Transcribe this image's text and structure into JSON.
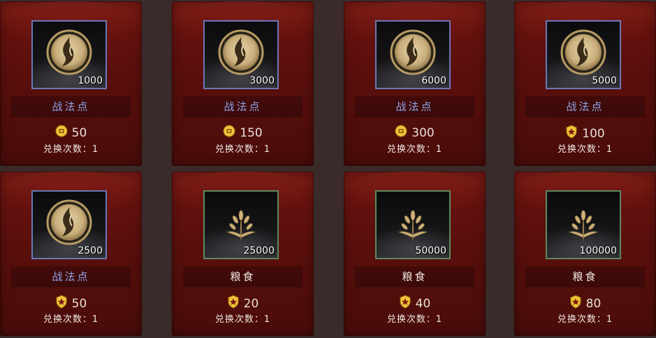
{
  "exchange_limit_label": "兑换次数：1",
  "colors": {
    "card_bg": "#5a0f0c",
    "frame_blue": "#6a78b8",
    "frame_green": "#5e8a5e",
    "name_blue": "#8ea4e6",
    "name_white": "#f0e6de",
    "gold": "#f2c23a"
  },
  "items": [
    {
      "name": "战法点",
      "quantity": "1000",
      "icon": "battle-method-emblem-icon",
      "frame": "blue",
      "currency_icon": "gold-coin-icon",
      "price": "50",
      "limit": "兑换次数：1"
    },
    {
      "name": "战法点",
      "quantity": "3000",
      "icon": "battle-method-emblem-icon",
      "frame": "blue",
      "currency_icon": "gold-coin-icon",
      "price": "150",
      "limit": "兑换次数：1"
    },
    {
      "name": "战法点",
      "quantity": "6000",
      "icon": "battle-method-emblem-icon",
      "frame": "blue",
      "currency_icon": "gold-coin-icon",
      "price": "300",
      "limit": "兑换次数：1"
    },
    {
      "name": "战法点",
      "quantity": "5000",
      "icon": "battle-method-emblem-icon",
      "frame": "blue",
      "currency_icon": "shield-token-icon",
      "price": "100",
      "limit": "兑换次数：1"
    },
    {
      "name": "战法点",
      "quantity": "2500",
      "icon": "battle-method-emblem-icon",
      "frame": "blue",
      "currency_icon": "shield-token-icon",
      "price": "50",
      "limit": "兑换次数：1"
    },
    {
      "name": "粮食",
      "quantity": "25000",
      "icon": "grain-icon",
      "frame": "green",
      "currency_icon": "shield-token-icon",
      "price": "20",
      "limit": "兑换次数：1"
    },
    {
      "name": "粮食",
      "quantity": "50000",
      "icon": "grain-icon",
      "frame": "green",
      "currency_icon": "shield-token-icon",
      "price": "40",
      "limit": "兑换次数：1"
    },
    {
      "name": "粮食",
      "quantity": "100000",
      "icon": "grain-icon",
      "frame": "green",
      "currency_icon": "shield-token-icon",
      "price": "80",
      "limit": "兑换次数：1"
    }
  ]
}
